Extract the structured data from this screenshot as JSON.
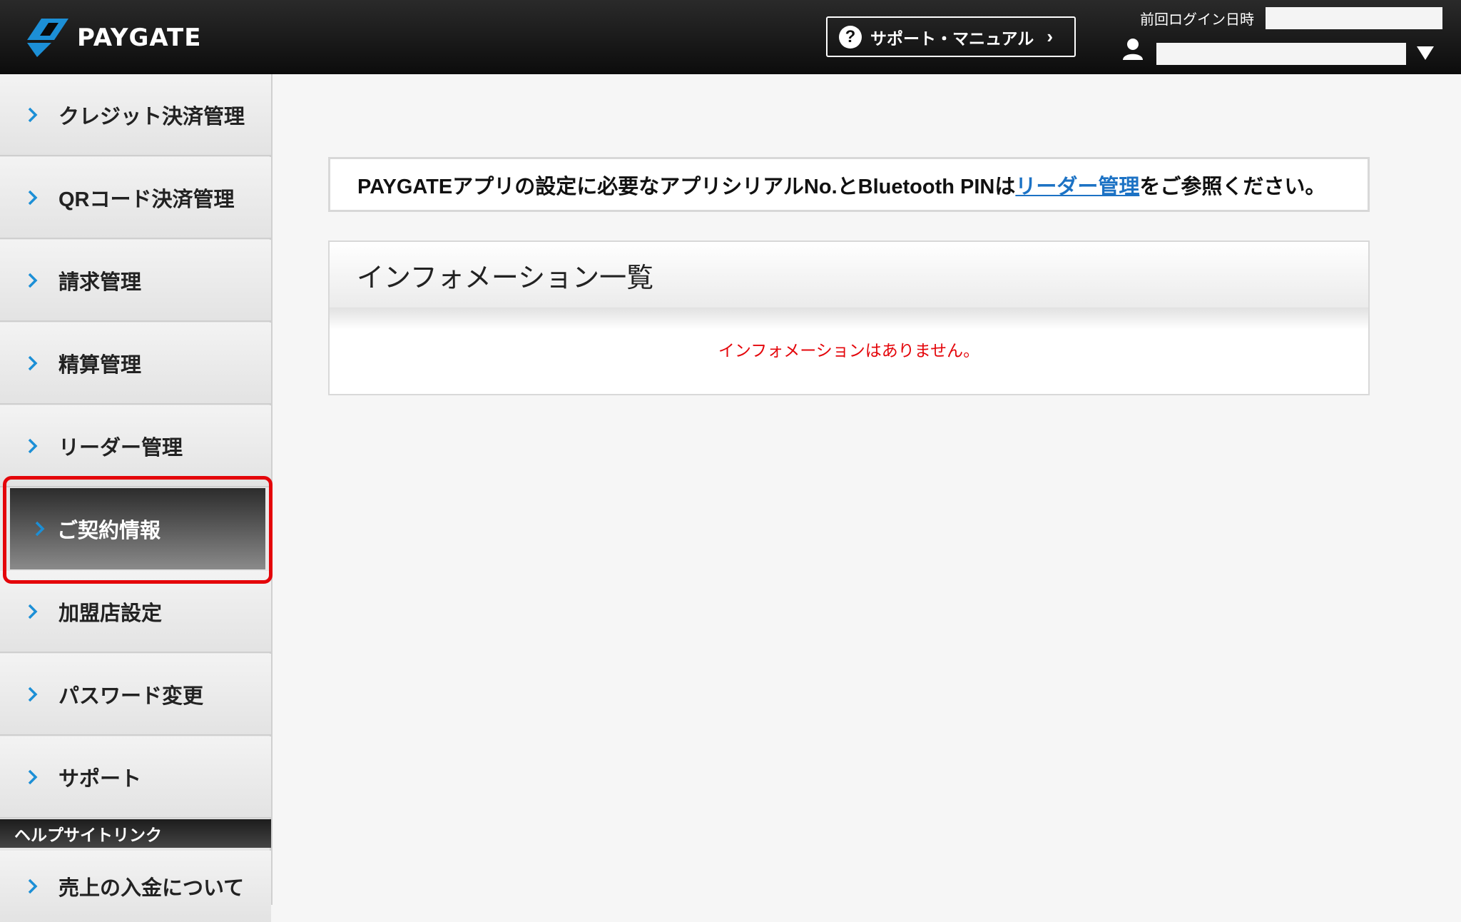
{
  "header": {
    "logo_text": "PAYGATE",
    "support_label": "サポート・マニュアル",
    "last_login_label": "前回ログイン日時"
  },
  "sidebar": {
    "items": [
      {
        "label": "クレジット決済管理"
      },
      {
        "label": "QRコード決済管理"
      },
      {
        "label": "請求管理"
      },
      {
        "label": "精算管理"
      },
      {
        "label": "リーダー管理"
      },
      {
        "label": "ご契約情報",
        "active": true
      },
      {
        "label": "加盟店設定"
      },
      {
        "label": "パスワード変更"
      },
      {
        "label": "サポート"
      }
    ],
    "help_header": "ヘルプサイトリンク",
    "help_items": [
      {
        "label": "売上の入金について"
      }
    ]
  },
  "main": {
    "notice": {
      "prefix": "PAYGATEアプリの設定に必要なアプリシリアルNo.とBluetooth PINは",
      "link": "リーダー管理",
      "suffix": "をご参照ください。"
    },
    "info_title": "インフォメーション一覧",
    "info_empty": "インフォメーションはありません。"
  },
  "colors": {
    "accent_blue": "#1c8fd6",
    "highlight_red": "#e4050a",
    "link_blue": "#1c72c4"
  },
  "icons": [
    "logo-mark-icon",
    "question-circle-icon",
    "chevron-right-icon",
    "user-icon",
    "triangle-down-icon"
  ]
}
